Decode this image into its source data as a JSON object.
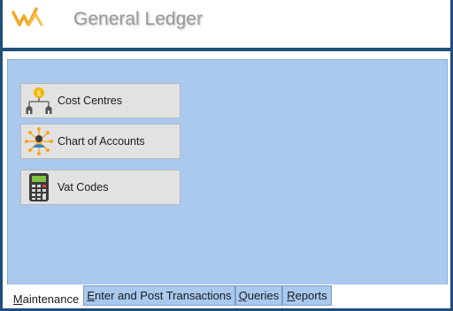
{
  "app": {
    "title": "General Ledger"
  },
  "menu": {
    "items": [
      {
        "label": "Cost Centres",
        "icon": "cost-centres-icon"
      },
      {
        "label": "Chart of Accounts",
        "icon": "chart-of-accounts-icon"
      },
      {
        "label": "Vat Codes",
        "icon": "calculator-icon"
      }
    ]
  },
  "tabs": [
    {
      "label": "Maintenance",
      "first": "M",
      "rest": "aintenance",
      "active": true
    },
    {
      "label": "Enter and Post Transactions",
      "first": "E",
      "rest": "nter and Post Transactions",
      "active": false
    },
    {
      "label": "Queries",
      "first": "Q",
      "rest": "ueries",
      "active": false
    },
    {
      "label": "Reports",
      "first": "R",
      "rest": "eports",
      "active": false
    }
  ],
  "colors": {
    "panel": "#a9c9ef",
    "brand_rule": "#1f4e79",
    "logo_orange": "#f5a623"
  }
}
